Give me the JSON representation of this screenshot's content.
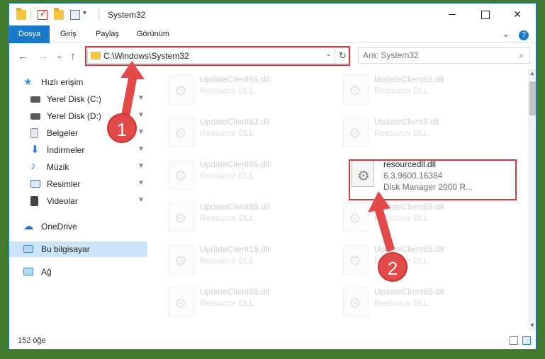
{
  "window": {
    "title": "System32",
    "controls": {
      "minimize": "–",
      "maximize": "□",
      "close": "✕"
    }
  },
  "ribbon": {
    "tabs": [
      "Dosya",
      "Giriş",
      "Paylaş",
      "Görünüm"
    ],
    "expand": "⌄",
    "help": "?"
  },
  "nav": {
    "back": "←",
    "forward": "→",
    "recent": "⌄",
    "up": "↑",
    "address": "C:\\Windows\\System32",
    "address_dropdown": "⌄",
    "refresh": "↻",
    "search_placeholder": "Ara: System32",
    "search_icon": "⌕"
  },
  "sidebar": {
    "items": [
      {
        "label": "Hızlı erişim",
        "icon": "star-icon",
        "color": "#2f8fe6",
        "pinned": false
      },
      {
        "label": "Yerel Disk (C:)",
        "icon": "drive-icon",
        "color": "#3a3a3a",
        "pinned": true
      },
      {
        "label": "Yerel Disk (D:)",
        "icon": "drive-icon",
        "color": "#3a3a3a",
        "pinned": true
      },
      {
        "label": "Belgeler",
        "icon": "documents-icon",
        "color": "#7d8ea3",
        "pinned": true
      },
      {
        "label": "İndirmeler",
        "icon": "downloads-icon",
        "color": "#2f7fd6",
        "pinned": true
      },
      {
        "label": "Müzik",
        "icon": "music-icon",
        "color": "#2f7fd6",
        "pinned": true
      },
      {
        "label": "Resimler",
        "icon": "pictures-icon",
        "color": "#4a6fa5",
        "pinned": true
      },
      {
        "label": "Videolar",
        "icon": "videos-icon",
        "color": "#444",
        "pinned": true
      },
      {
        "label": "OneDrive",
        "icon": "cloud-icon",
        "color": "#1f6fd0",
        "pinned": false
      },
      {
        "label": "Bu bilgisayar",
        "icon": "computer-icon",
        "color": "#3b86c8",
        "pinned": false
      },
      {
        "label": "Ağ",
        "icon": "network-icon",
        "color": "#3b86c8",
        "pinned": false
      }
    ],
    "pin_glyph": "📌"
  },
  "files": [
    {
      "name": "UpdateClient65.dll",
      "desc": "Resource DLL",
      "faded": true
    },
    {
      "name": "UpdateClient65.dll",
      "desc": "Resource DLL",
      "faded": true
    },
    {
      "name": "UpdateClient63.dll",
      "desc": "Resource DLL",
      "faded": true
    },
    {
      "name": "UpdateClient5.dll",
      "desc": "Resource DLL",
      "faded": true
    },
    {
      "name": "UpdateClient65.dll",
      "desc": "Resource DLL",
      "faded": true
    },
    {
      "name": "resourcedll.dll",
      "desc": "6.3.9600.16384",
      "desc2": "Disk Manager 2000 R...",
      "faded": false
    },
    {
      "name": "UpdateClient65.dll",
      "desc": "Resource DLL",
      "faded": true
    },
    {
      "name": "UpdateClient65.dll",
      "desc": "Resource DLL",
      "faded": true
    },
    {
      "name": "UpdateClient19.dll",
      "desc": "Resource DLL",
      "faded": true
    },
    {
      "name": "UpdateClient65.dll",
      "desc": "Resource DLL",
      "faded": true
    },
    {
      "name": "UpdateClient65.dll",
      "desc": "Resource DLL",
      "faded": true
    },
    {
      "name": "UpdateClient65.dll",
      "desc": "Resource DLL",
      "faded": true
    }
  ],
  "status": {
    "count": "152 öğe"
  },
  "annotations": {
    "step1": "1",
    "step2": "2",
    "color": "#e24a4a"
  }
}
